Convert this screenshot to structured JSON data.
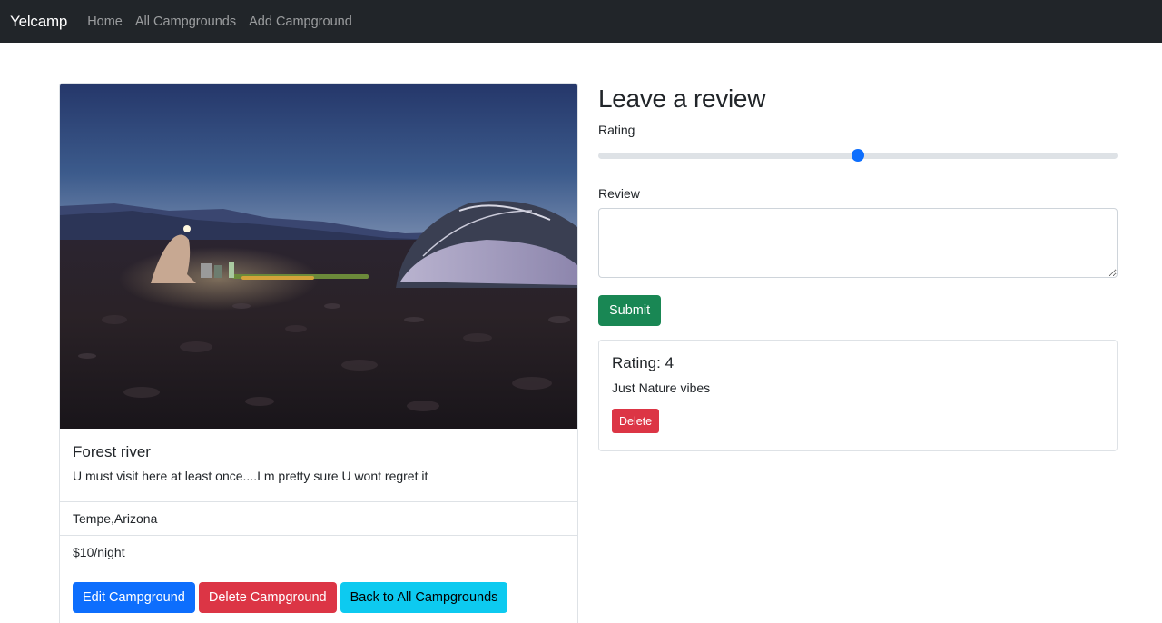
{
  "navbar": {
    "brand": "Yelcamp",
    "links": [
      "Home",
      "All Campgrounds",
      "Add Campground"
    ]
  },
  "campground": {
    "title": "Forest river",
    "description": "U must visit here at least once....I m pretty sure U wont regret it",
    "location": "Tempe,Arizona",
    "price": "$10/night",
    "actions": {
      "edit": "Edit Campground",
      "delete": "Delete Campground",
      "back": "Back to All Campgrounds"
    }
  },
  "review_form": {
    "heading": "Leave a review",
    "rating_label": "Rating",
    "rating_fraction": 0.5,
    "review_label": "Review",
    "review_value": "",
    "submit_label": "Submit"
  },
  "reviews": [
    {
      "rating": "Rating: 4",
      "text": "Just Nature vibes",
      "delete_label": "Delete"
    }
  ],
  "colors": {
    "navbar_bg": "#212529",
    "primary": "#0d6efd",
    "danger": "#dc3545",
    "info": "#0dcaf0",
    "success": "#198754"
  }
}
